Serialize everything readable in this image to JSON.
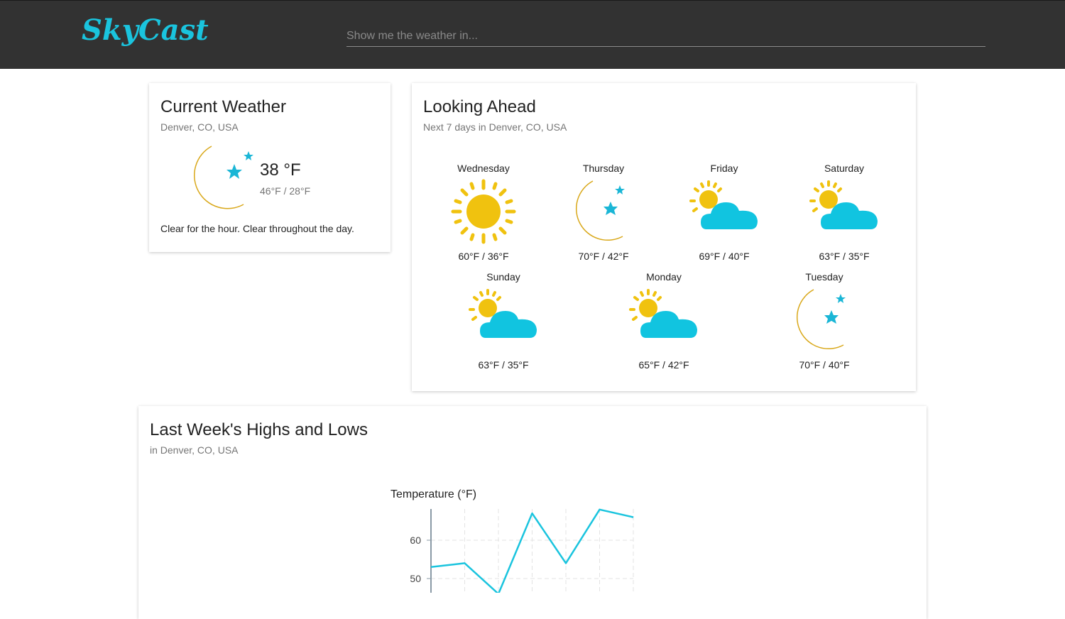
{
  "app": {
    "logo": "SkyCast"
  },
  "search": {
    "placeholder": "Show me the weather in..."
  },
  "current": {
    "title": "Current Weather",
    "location": "Denver, CO, USA",
    "icon": "clear-night-icon",
    "temperature": "38 °F",
    "range": "46°F / 28°F",
    "summary": "Clear for the hour. Clear throughout the day."
  },
  "forecast": {
    "title": "Looking Ahead",
    "subtitle": "Next 7 days in Denver, CO, USA",
    "days": [
      {
        "day": "Wednesday",
        "icon": "clear-day-icon",
        "temps": "60°F / 36°F"
      },
      {
        "day": "Thursday",
        "icon": "clear-night-icon",
        "temps": "70°F / 42°F"
      },
      {
        "day": "Friday",
        "icon": "partly-cloudy-day-icon",
        "temps": "69°F / 40°F"
      },
      {
        "day": "Saturday",
        "icon": "partly-cloudy-day-icon",
        "temps": "63°F / 35°F"
      },
      {
        "day": "Sunday",
        "icon": "partly-cloudy-day-icon",
        "temps": "63°F / 35°F"
      },
      {
        "day": "Monday",
        "icon": "partly-cloudy-day-icon",
        "temps": "65°F / 42°F"
      },
      {
        "day": "Tuesday",
        "icon": "clear-night-icon",
        "temps": "70°F / 40°F"
      }
    ]
  },
  "history": {
    "title": "Last Week's Highs and Lows",
    "subtitle": "in Denver, CO, USA"
  },
  "colors": {
    "header_bg": "#323232",
    "accent": "#1ac4de",
    "sun": "#f0c20f",
    "moon": "#f0c02a",
    "cloud": "#11c4e0"
  },
  "chart_data": {
    "type": "line",
    "title": "",
    "ylabel": "Temperature (°F)",
    "xlabel": "",
    "ylim": [
      45,
      70
    ],
    "yticks": [
      50,
      60
    ],
    "grid": true,
    "series": [
      {
        "values": [
          53,
          54,
          46,
          67,
          54,
          68,
          66
        ]
      }
    ]
  }
}
